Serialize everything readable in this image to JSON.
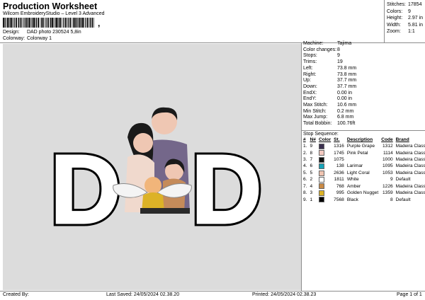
{
  "header": {
    "title": "Production Worksheet",
    "subtitle": "Wilcom EmbroideryStudio – Level 3 Advanced",
    "barcode_suffix": ",",
    "design_label": "Design:",
    "design_value": "DAD photo 230524 5,8in",
    "colorway_label": "Colorway:",
    "colorway_value": "Colorway 1"
  },
  "summary": {
    "stitches_label": "Stitches:",
    "stitches": "17854",
    "colors_label": "Colors:",
    "colors": "9",
    "height_label": "Height:",
    "height": "2.97 in",
    "width_label": "Width:",
    "width": "5.81 in",
    "zoom_label": "Zoom:",
    "zoom": "1:1"
  },
  "specs": [
    {
      "label": "Machine:",
      "value": "Tajima"
    },
    {
      "label": "Color changes:",
      "value": "8"
    },
    {
      "label": "Stops:",
      "value": "9"
    },
    {
      "label": "Trims:",
      "value": "19"
    },
    {
      "label": "Left:",
      "value": "73.8 mm"
    },
    {
      "label": "Right:",
      "value": "73.8 mm"
    },
    {
      "label": "Up:",
      "value": "37.7 mm"
    },
    {
      "label": "Down:",
      "value": "37.7 mm"
    },
    {
      "label": "EndX:",
      "value": "0.00 in"
    },
    {
      "label": "EndY:",
      "value": "0.00 in"
    },
    {
      "label": "Max Stitch:",
      "value": "10.6 mm"
    },
    {
      "label": "Min Stitch:",
      "value": "0.2 mm"
    },
    {
      "label": "Max Jump:",
      "value": "6.8 mm"
    },
    {
      "label": "Total Bobbin:",
      "value": "100.76ft"
    }
  ],
  "stop_sequence": {
    "title": "Stop Sequence:",
    "headers": {
      "num": "#",
      "n": "N#",
      "color": "Color",
      "st": "St.",
      "desc": "Description",
      "code": "Code",
      "brand": "Brand"
    },
    "rows": [
      {
        "num": "1.",
        "n": "9",
        "color": "#3a2f4f",
        "st": "1316",
        "desc": "Purple Grape",
        "code": "1312",
        "brand": "Madeira Classic 40"
      },
      {
        "num": "2.",
        "n": "8",
        "color": "#f3c9c0",
        "st": "1745",
        "desc": "Pink Petal",
        "code": "1114",
        "brand": "Madeira Classic 40"
      },
      {
        "num": "3.",
        "n": "7",
        "color": "#111111",
        "st": "1075",
        "desc": "",
        "code": "1000",
        "brand": "Madeira Classic 40"
      },
      {
        "num": "4.",
        "n": "6",
        "color": "#18a3b8",
        "st": "138",
        "desc": "Larimar",
        "code": "1095",
        "brand": "Madeira Classic 40"
      },
      {
        "num": "5.",
        "n": "5",
        "color": "#efc3b0",
        "st": "2636",
        "desc": "Light Coral",
        "code": "1053",
        "brand": "Madeira Classic 40"
      },
      {
        "num": "6.",
        "n": "2",
        "color": "#ffffff",
        "st": "1811",
        "desc": "White",
        "code": "9",
        "brand": "Default"
      },
      {
        "num": "7.",
        "n": "4",
        "color": "#c98a45",
        "st": "768",
        "desc": "Amber",
        "code": "1226",
        "brand": "Madeira Classic 40"
      },
      {
        "num": "8.",
        "n": "3",
        "color": "#dcb227",
        "st": "995",
        "desc": "Golden Nugget",
        "code": "1359",
        "brand": "Madeira Classic 40"
      },
      {
        "num": "9.",
        "n": "1",
        "color": "#000000",
        "st": "7568",
        "desc": "Black",
        "code": "8",
        "brand": "Default"
      }
    ]
  },
  "design_letters": {
    "left": "D",
    "right": "D"
  },
  "footer": {
    "created_by": "Created By:",
    "last_saved": "Last Saved: 24/05/2024 02.38.20",
    "printed": "Printed: 24/05/2024 02.38.23",
    "page": "Page 1 of 1"
  }
}
